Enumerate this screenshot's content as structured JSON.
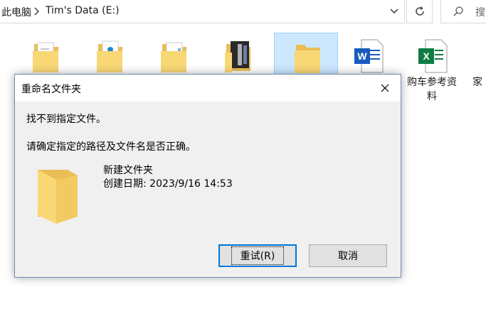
{
  "explorer": {
    "breadcrumb_1": "此电脑",
    "breadcrumb_2": "Tim's Data (E:)",
    "search_placeholder": "搜"
  },
  "files": [
    {
      "name": "",
      "type": "folder-docs"
    },
    {
      "name": "",
      "type": "folder-blue-doc"
    },
    {
      "name": "",
      "type": "folder-docs"
    },
    {
      "name": "",
      "type": "folder-dark-images"
    },
    {
      "name": "",
      "type": "folder-selected"
    },
    {
      "name": "",
      "type": "word-doc"
    },
    {
      "name": "购车参考资料",
      "type": "excel-doc"
    },
    {
      "name": "家",
      "type": "partial"
    }
  ],
  "labels": {
    "excel_line1": "购车参考资",
    "excel_line2": "料",
    "partial": "家"
  },
  "dialog": {
    "title": "重命名文件夹",
    "message_1": "找不到指定文件。",
    "message_2": "请确定指定的路径及文件名是否正确。",
    "folder_name": "新建文件夹",
    "created": "创建日期: 2023/9/16 14:53",
    "retry_label": "重试(R)",
    "cancel_label": "取消"
  },
  "colors": {
    "folder": "#f8d775",
    "selection": "#cce8ff",
    "word": "#185abd",
    "excel": "#107c41",
    "accent": "#0078d7"
  }
}
